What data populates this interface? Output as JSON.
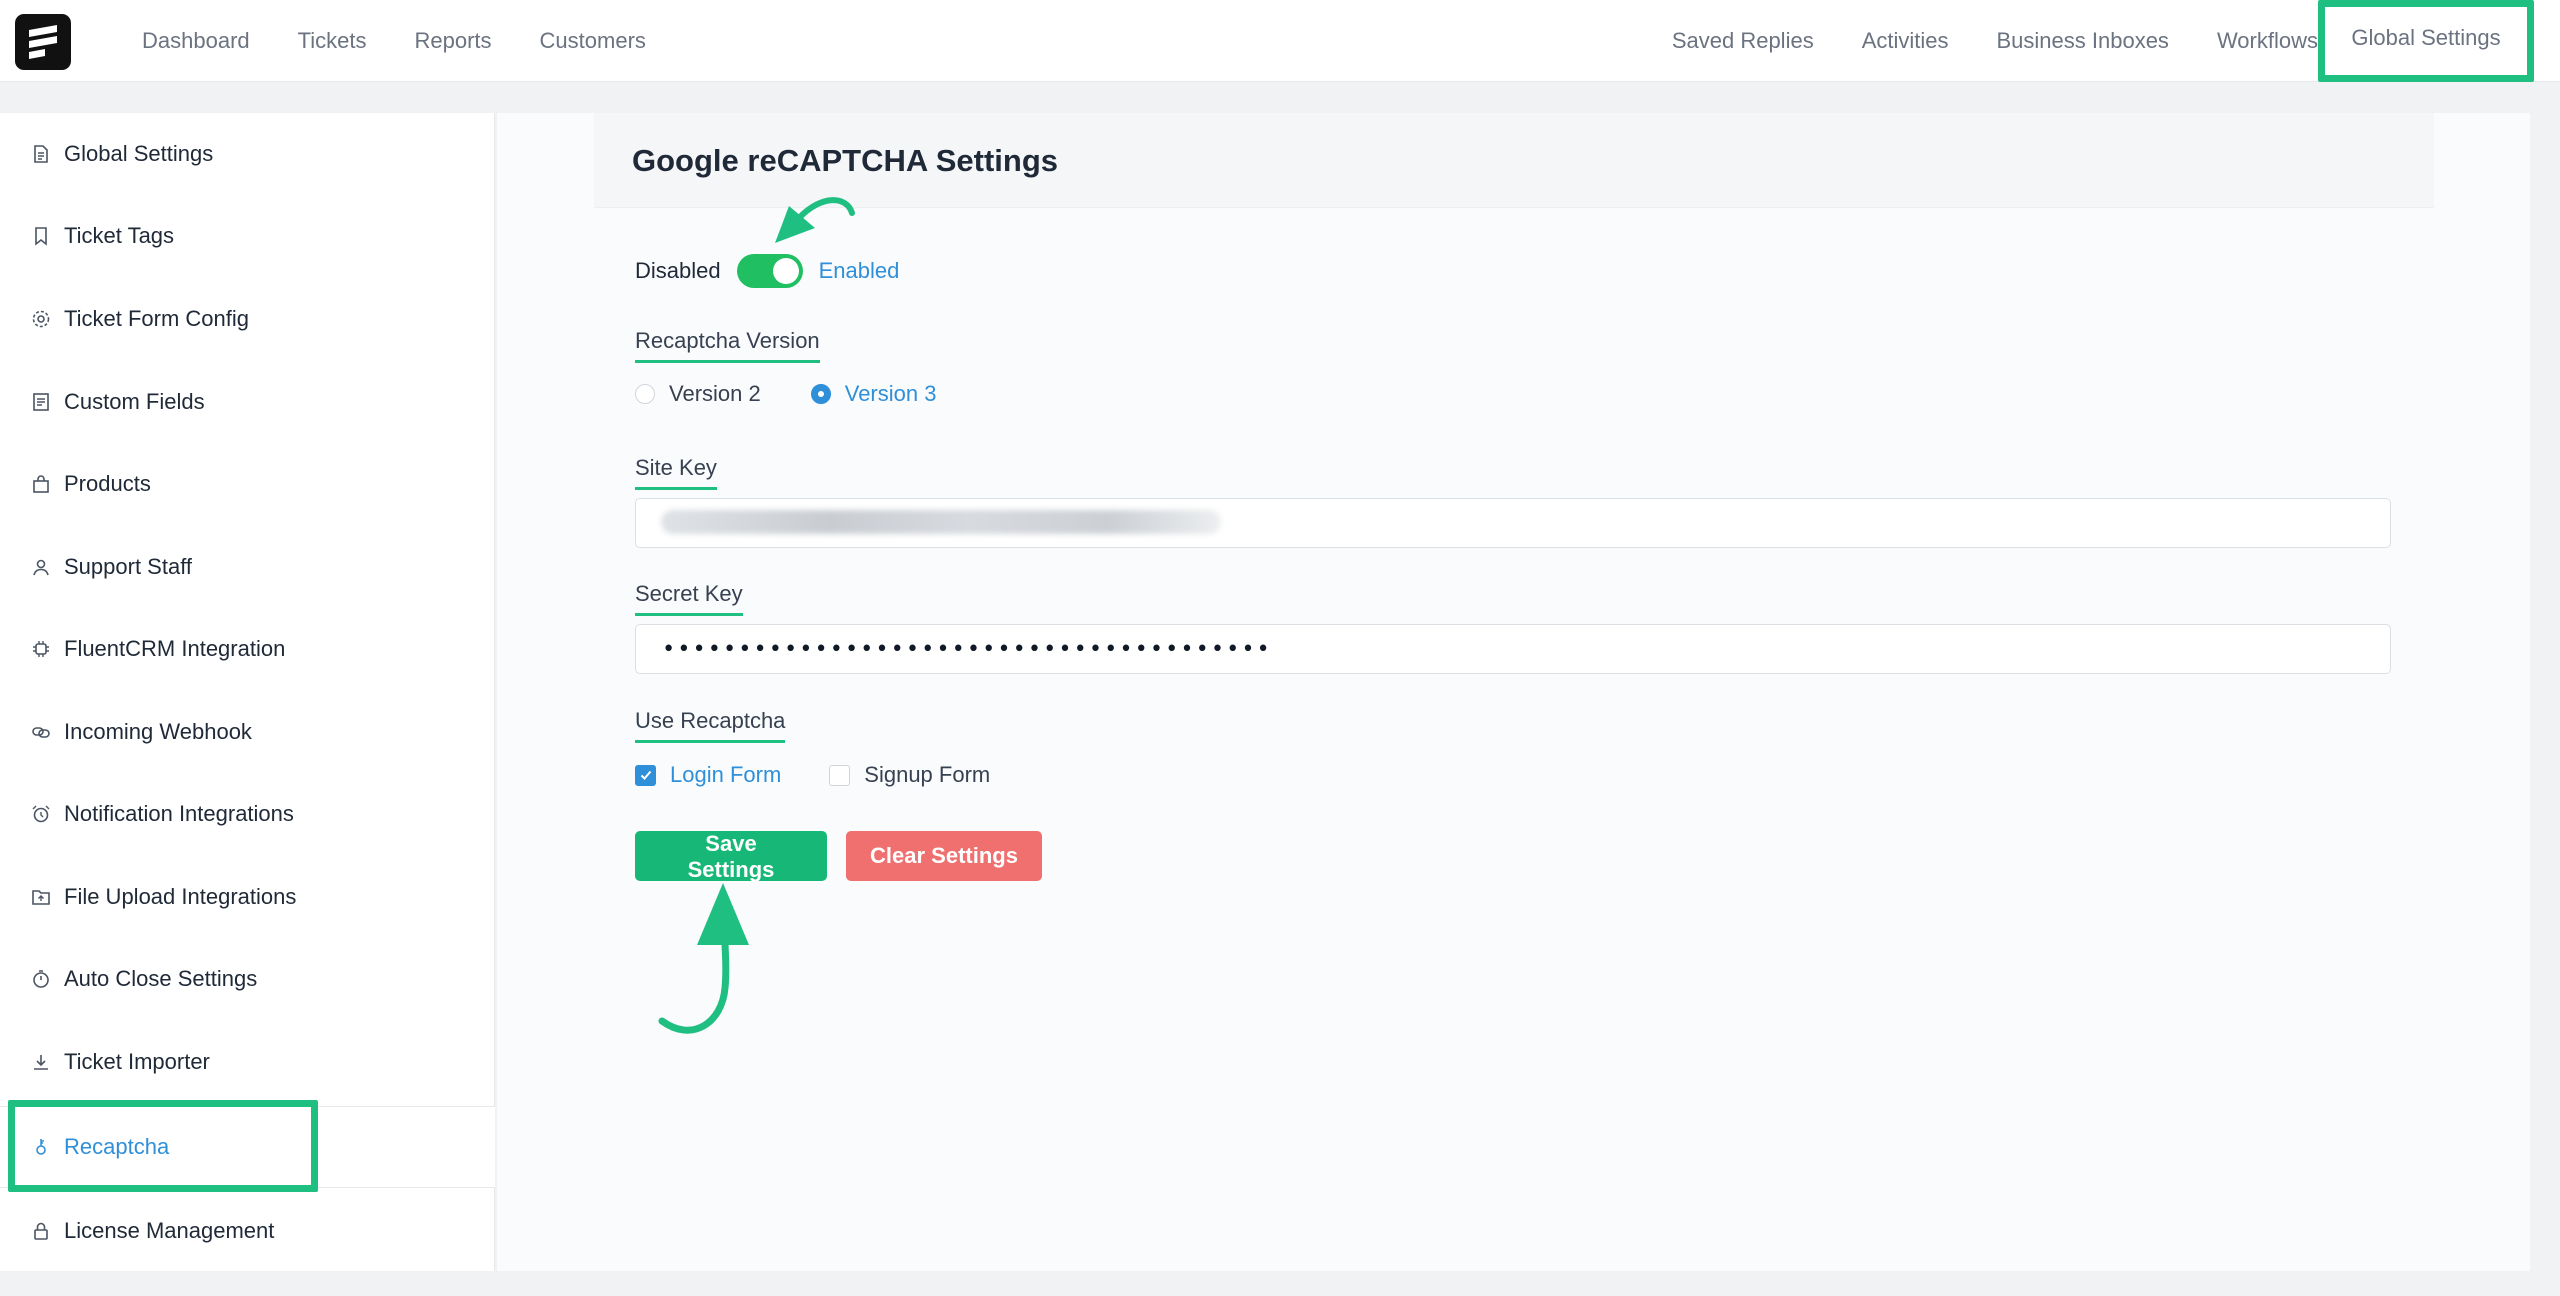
{
  "topnav": {
    "left": [
      "Dashboard",
      "Tickets",
      "Reports",
      "Customers"
    ],
    "right": [
      "Saved Replies",
      "Activities",
      "Business Inboxes",
      "Workflows"
    ],
    "active": "Global Settings"
  },
  "sidebar": {
    "items": [
      {
        "label": "Global Settings",
        "icon": "document-icon"
      },
      {
        "label": "Ticket Tags",
        "icon": "bookmark-icon"
      },
      {
        "label": "Ticket Form Config",
        "icon": "gear-icon"
      },
      {
        "label": "Custom Fields",
        "icon": "list-icon"
      },
      {
        "label": "Products",
        "icon": "bag-icon"
      },
      {
        "label": "Support Staff",
        "icon": "user-icon"
      },
      {
        "label": "FluentCRM Integration",
        "icon": "chip-icon"
      },
      {
        "label": "Incoming Webhook",
        "icon": "link-icon"
      },
      {
        "label": "Notification Integrations",
        "icon": "alarm-icon"
      },
      {
        "label": "File Upload Integrations",
        "icon": "folder-icon"
      },
      {
        "label": "Auto Close Settings",
        "icon": "timer-icon"
      },
      {
        "label": "Ticket Importer",
        "icon": "download-icon"
      },
      {
        "label": "Recaptcha",
        "icon": "key-icon"
      },
      {
        "label": "License Management",
        "icon": "lock-icon"
      }
    ],
    "active": "Recaptcha"
  },
  "main": {
    "title": "Google reCAPTCHA Settings",
    "toggle": {
      "off_label": "Disabled",
      "on_label": "Enabled",
      "enabled": true
    },
    "version": {
      "label": "Recaptcha Version",
      "options": [
        "Version 2",
        "Version 3"
      ],
      "selected": "Version 3"
    },
    "site_key": {
      "label": "Site Key"
    },
    "secret_key": {
      "label": "Secret Key",
      "value": "••••••••••••••••••••••••••••••••••••••••"
    },
    "use": {
      "label": "Use Recaptcha",
      "options": [
        {
          "label": "Login Form",
          "checked": true
        },
        {
          "label": "Signup Form",
          "checked": false
        }
      ]
    },
    "save_label": "Save Settings",
    "clear_label": "Clear Settings"
  },
  "colors": {
    "accent": "#1fbf82",
    "link": "#2f8fd8",
    "danger": "#f07070"
  }
}
